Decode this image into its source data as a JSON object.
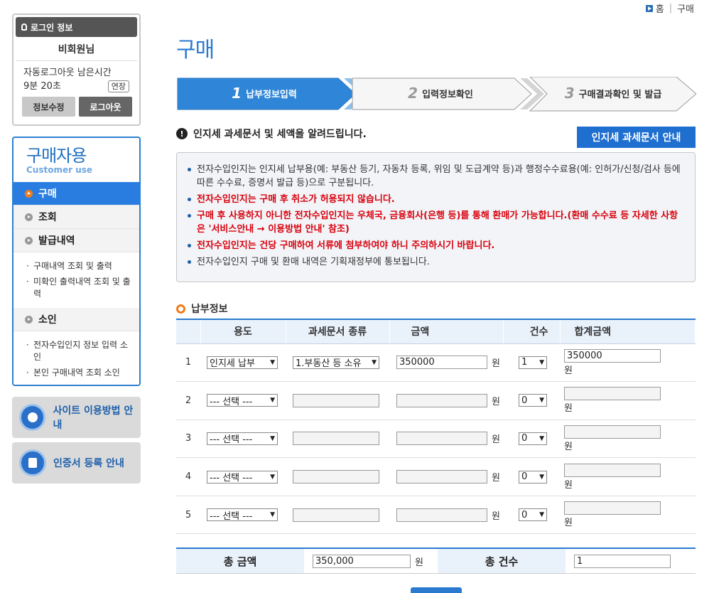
{
  "topnav": {
    "home": "홈",
    "current": "구매"
  },
  "login": {
    "title": "로그인 정보",
    "user": "비회원님",
    "timer_label": "자동로그아웃 남은시간",
    "timer_value": "9분 20초",
    "extend": "연장",
    "edit": "정보수정",
    "logout": "로그아웃"
  },
  "menu": {
    "title_ko": "구매자용",
    "title_en": "Customer use",
    "items": [
      {
        "label": "구매"
      },
      {
        "label": "조회"
      },
      {
        "label": "발급내역"
      },
      {
        "label": "소인"
      }
    ],
    "sub_issue": [
      "구매내역 조회 및 출력",
      "미확인 출력내역 조회 및 출력"
    ],
    "sub_stamp": [
      "전자수입인지 정보 입력 소인",
      "본인 구매내역 조회 소인"
    ]
  },
  "banners": {
    "guide": "사이트 이용방법 안내",
    "cert": "인증서 등록 안내"
  },
  "page_title": "구매",
  "steps": [
    {
      "num": "1",
      "label": "납부정보입력"
    },
    {
      "num": "2",
      "label": "입력정보확인"
    },
    {
      "num": "3",
      "label": "구매결과확인 및 발급"
    }
  ],
  "info": {
    "heading": "인지세 과세문서 및 세액을 알려드립니다.",
    "button": "인지세 과세문서 안내",
    "notices": [
      {
        "text": "전자수입인지는 인지세 납부용(예: 부동산 등기, 자동차 등록, 위임 및 도급계약 등)과 행정수수료용(예: 인허가/신청/검사 등에 따른 수수료, 증명서 발급 등)으로 구분됩니다.",
        "red": false
      },
      {
        "text": "전자수입인지는 구매 후 취소가 허용되지 않습니다.",
        "red": true
      },
      {
        "text": "구매 후 사용하지 아니한 전자수입인지는 우체국, 금융회사(은행 등)를 통해 환매가 가능합니다.(환매 수수료 등 자세한 사항은 '서비스안내 → 이용방법 안내' 참조)",
        "red": true
      },
      {
        "text": "전자수입인지는 건당 구매하여 서류에 첨부하여야 하니 주의하시기 바랍니다.",
        "red": true
      },
      {
        "text": "전자수입인지 구매 및 환매 내역은 기획재정부에 통보됩니다.",
        "red": false
      }
    ]
  },
  "payment": {
    "heading": "납부정보",
    "headers": [
      "용도",
      "과세문서 종류",
      "금액",
      "건수",
      "합계금액"
    ],
    "unit": "원",
    "rows": [
      {
        "no": "1",
        "purpose": "인지세 납부",
        "doc_type": "1.부동산 등 소유",
        "amount": "350000",
        "count": "1",
        "total": "350000"
      },
      {
        "no": "2",
        "purpose": "--- 선택 ---",
        "doc_type": "",
        "amount": "",
        "count": "0",
        "total": ""
      },
      {
        "no": "3",
        "purpose": "--- 선택 ---",
        "doc_type": "",
        "amount": "",
        "count": "0",
        "total": ""
      },
      {
        "no": "4",
        "purpose": "--- 선택 ---",
        "doc_type": "",
        "amount": "",
        "count": "0",
        "total": ""
      },
      {
        "no": "5",
        "purpose": "--- 선택 ---",
        "doc_type": "",
        "amount": "",
        "count": "0",
        "total": ""
      }
    ]
  },
  "totals": {
    "amount_label": "총 금액",
    "amount": "350,000",
    "unit": "원",
    "count_label": "총 건수",
    "count": "1"
  }
}
